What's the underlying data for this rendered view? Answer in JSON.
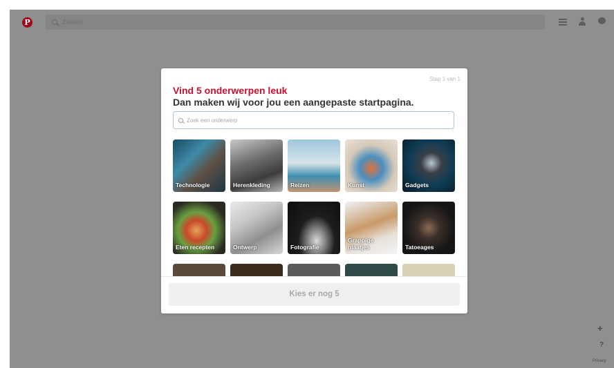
{
  "topbar": {
    "logo_text": "P",
    "search_placeholder": "Zoeken",
    "icons": [
      "search-icon",
      "menu-icon",
      "user-icon",
      "chat-icon"
    ]
  },
  "modal": {
    "step": "Stap 1 van 1",
    "title": "Vind 5 onderwerpen leuk",
    "subtitle": "Dan maken wij voor jou een aangepaste startpagina.",
    "search_placeholder": "Zoek een onderwerp",
    "topics": [
      {
        "label": "Technologie"
      },
      {
        "label": "Herenkleding"
      },
      {
        "label": "Reizen"
      },
      {
        "label": "Kunst"
      },
      {
        "label": "Gadgets"
      },
      {
        "label": "Eten recepten"
      },
      {
        "label": "Ontwerp"
      },
      {
        "label": "Fotografie"
      },
      {
        "label": "Grappige plaatjes"
      },
      {
        "label": "Tatoeages"
      },
      {
        "label": ""
      },
      {
        "label": ""
      },
      {
        "label": ""
      },
      {
        "label": ""
      },
      {
        "label": ""
      }
    ],
    "cta_label": "Kies er nog 5"
  },
  "side": {
    "add_label": "+",
    "help_label": "?",
    "privacy_label": "Privacy"
  },
  "colors": {
    "brand_red": "#c8102e",
    "overlay": "#8f8f8f"
  }
}
